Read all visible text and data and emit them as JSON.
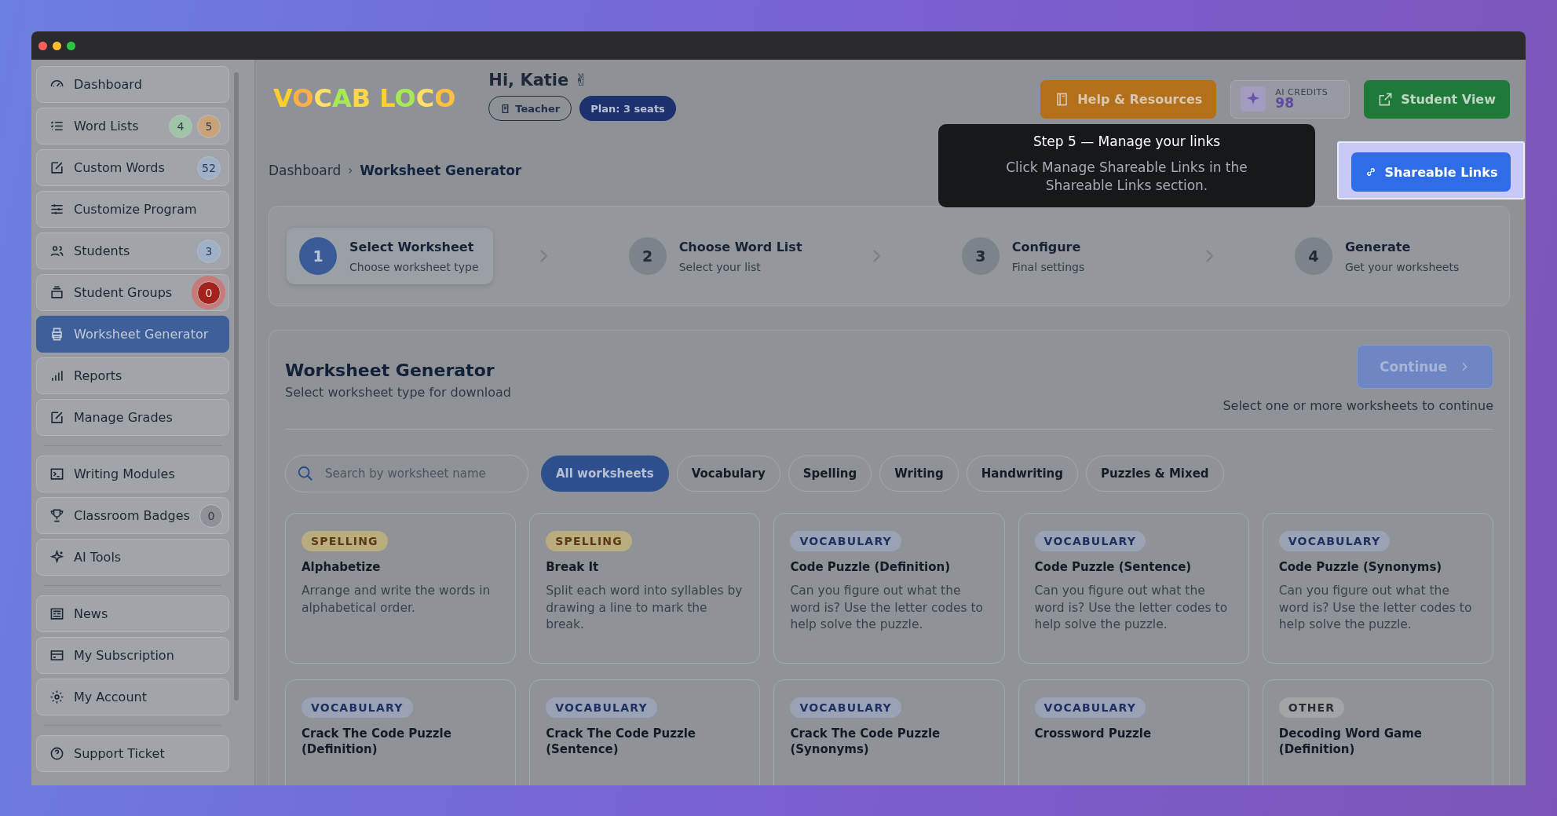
{
  "window": {
    "controls": [
      {
        "color": "#ff5f57"
      },
      {
        "color": "#febc2e"
      },
      {
        "color": "#28c840"
      }
    ]
  },
  "sidebar": {
    "groups": [
      {
        "items": [
          {
            "label": "Dashboard",
            "selected": false,
            "hotspot": false
          },
          {
            "label": "Word Lists",
            "selected": false,
            "hotspot": false,
            "badges": [
              {
                "text": "4",
                "color": "#9fc4a6"
              },
              {
                "text": "5",
                "color": "#c9a37a"
              }
            ]
          },
          {
            "label": "Custom Words",
            "selected": false,
            "hotspot": false,
            "badges": [
              {
                "text": "52",
                "color": "#9fb0c9"
              }
            ]
          },
          {
            "label": "Customize Program",
            "selected": false,
            "hotspot": false
          },
          {
            "label": "Students",
            "selected": false,
            "hotspot": false,
            "badges": [
              {
                "text": "3",
                "color": "#9fb0c9"
              }
            ]
          },
          {
            "label": "Student Groups",
            "selected": false,
            "hotspot": true,
            "badges": [
              {
                "text": "0",
                "color": "#a3221c"
              }
            ]
          },
          {
            "label": "Worksheet Generator",
            "selected": true,
            "hotspot": false
          },
          {
            "label": "Reports",
            "selected": false,
            "hotspot": false
          },
          {
            "label": "Manage Grades",
            "selected": false,
            "hotspot": false
          }
        ]
      },
      {
        "items": [
          {
            "label": "Writing Modules",
            "selected": false,
            "hotspot": false
          },
          {
            "label": "Classroom Badges",
            "selected": false,
            "hotspot": false,
            "badges": [
              {
                "text": "0",
                "color": "#8e9196"
              }
            ]
          },
          {
            "label": "AI Tools",
            "selected": false,
            "hotspot": false
          }
        ]
      },
      {
        "items": [
          {
            "label": "News",
            "selected": false,
            "hotspot": false
          },
          {
            "label": "My Subscription",
            "selected": false,
            "hotspot": false
          },
          {
            "label": "My Account",
            "selected": false,
            "hotspot": false
          }
        ]
      },
      {
        "items": [
          {
            "label": "Support Ticket",
            "selected": false,
            "hotspot": false
          }
        ]
      }
    ]
  },
  "header": {
    "logo": "VOCAB LOCO",
    "greeting": "Hi, Katie ✌",
    "role": "Teacher",
    "plan": "Plan: 3 seats",
    "help_button": "Help & Resources",
    "credits_label": "AI CREDITS",
    "credits_value": "98",
    "student_view_button": "Student View"
  },
  "breadcrumb": {
    "items": [
      "Dashboard",
      "Worksheet Generator"
    ],
    "separator": "›"
  },
  "shareable_links_button": "Shareable Links",
  "tour_tooltip": {
    "title": "Step 5 — Manage your links",
    "body": "Click Manage Shareable Links in the Shareable Links section."
  },
  "steps": [
    {
      "number": "1",
      "title": "Select Worksheet",
      "subtitle": "Choose worksheet type",
      "selected": true
    },
    {
      "number": "2",
      "title": "Choose Word List",
      "subtitle": "Select your list",
      "selected": false
    },
    {
      "number": "3",
      "title": "Configure",
      "subtitle": "Final settings",
      "selected": false
    },
    {
      "number": "4",
      "title": "Generate",
      "subtitle": "Get your worksheets",
      "selected": false
    }
  ],
  "panel": {
    "title": "Worksheet Generator",
    "subtitle": "Select worksheet type for download",
    "continue_button": "Continue",
    "continue_disabled": true,
    "hint": "Select one or more worksheets to continue",
    "search": {
      "placeholder": "Search by worksheet name"
    },
    "filters": [
      {
        "label": "All worksheets",
        "selected": true
      },
      {
        "label": "Vocabulary",
        "selected": false
      },
      {
        "label": "Spelling",
        "selected": false
      },
      {
        "label": "Writing",
        "selected": false
      },
      {
        "label": "Handwriting",
        "selected": false
      },
      {
        "label": "Puzzles & Mixed",
        "selected": false
      }
    ],
    "cards": [
      {
        "tag": "SPELLING",
        "kind": "spelling",
        "title": "Alphabetize",
        "description": "Arrange and write the words in alphabetical order."
      },
      {
        "tag": "SPELLING",
        "kind": "spelling",
        "title": "Break It",
        "description": "Split each word into syllables by drawing a line to mark the break."
      },
      {
        "tag": "VOCABULARY",
        "kind": "vocabulary",
        "title": "Code Puzzle (Definition)",
        "description": "Can you figure out what the word is? Use the letter codes to help solve the puzzle."
      },
      {
        "tag": "VOCABULARY",
        "kind": "vocabulary",
        "title": "Code Puzzle (Sentence)",
        "description": "Can you figure out what the word is? Use the letter codes to help solve the puzzle."
      },
      {
        "tag": "VOCABULARY",
        "kind": "vocabulary",
        "title": "Code Puzzle (Synonyms)",
        "description": "Can you figure out what the word is? Use the letter codes to help solve the puzzle."
      },
      {
        "tag": "VOCABULARY",
        "kind": "vocabulary",
        "title": "Crack The Code Puzzle (Definition)"
      },
      {
        "tag": "VOCABULARY",
        "kind": "vocabulary",
        "title": "Crack The Code Puzzle (Sentence)"
      },
      {
        "tag": "VOCABULARY",
        "kind": "vocabulary",
        "title": "Crack The Code Puzzle (Synonyms)"
      },
      {
        "tag": "VOCABULARY",
        "kind": "vocabulary",
        "title": "Crossword Puzzle"
      },
      {
        "tag": "OTHER",
        "kind": "other",
        "title": "Decoding Word Game (Definition)"
      }
    ]
  }
}
